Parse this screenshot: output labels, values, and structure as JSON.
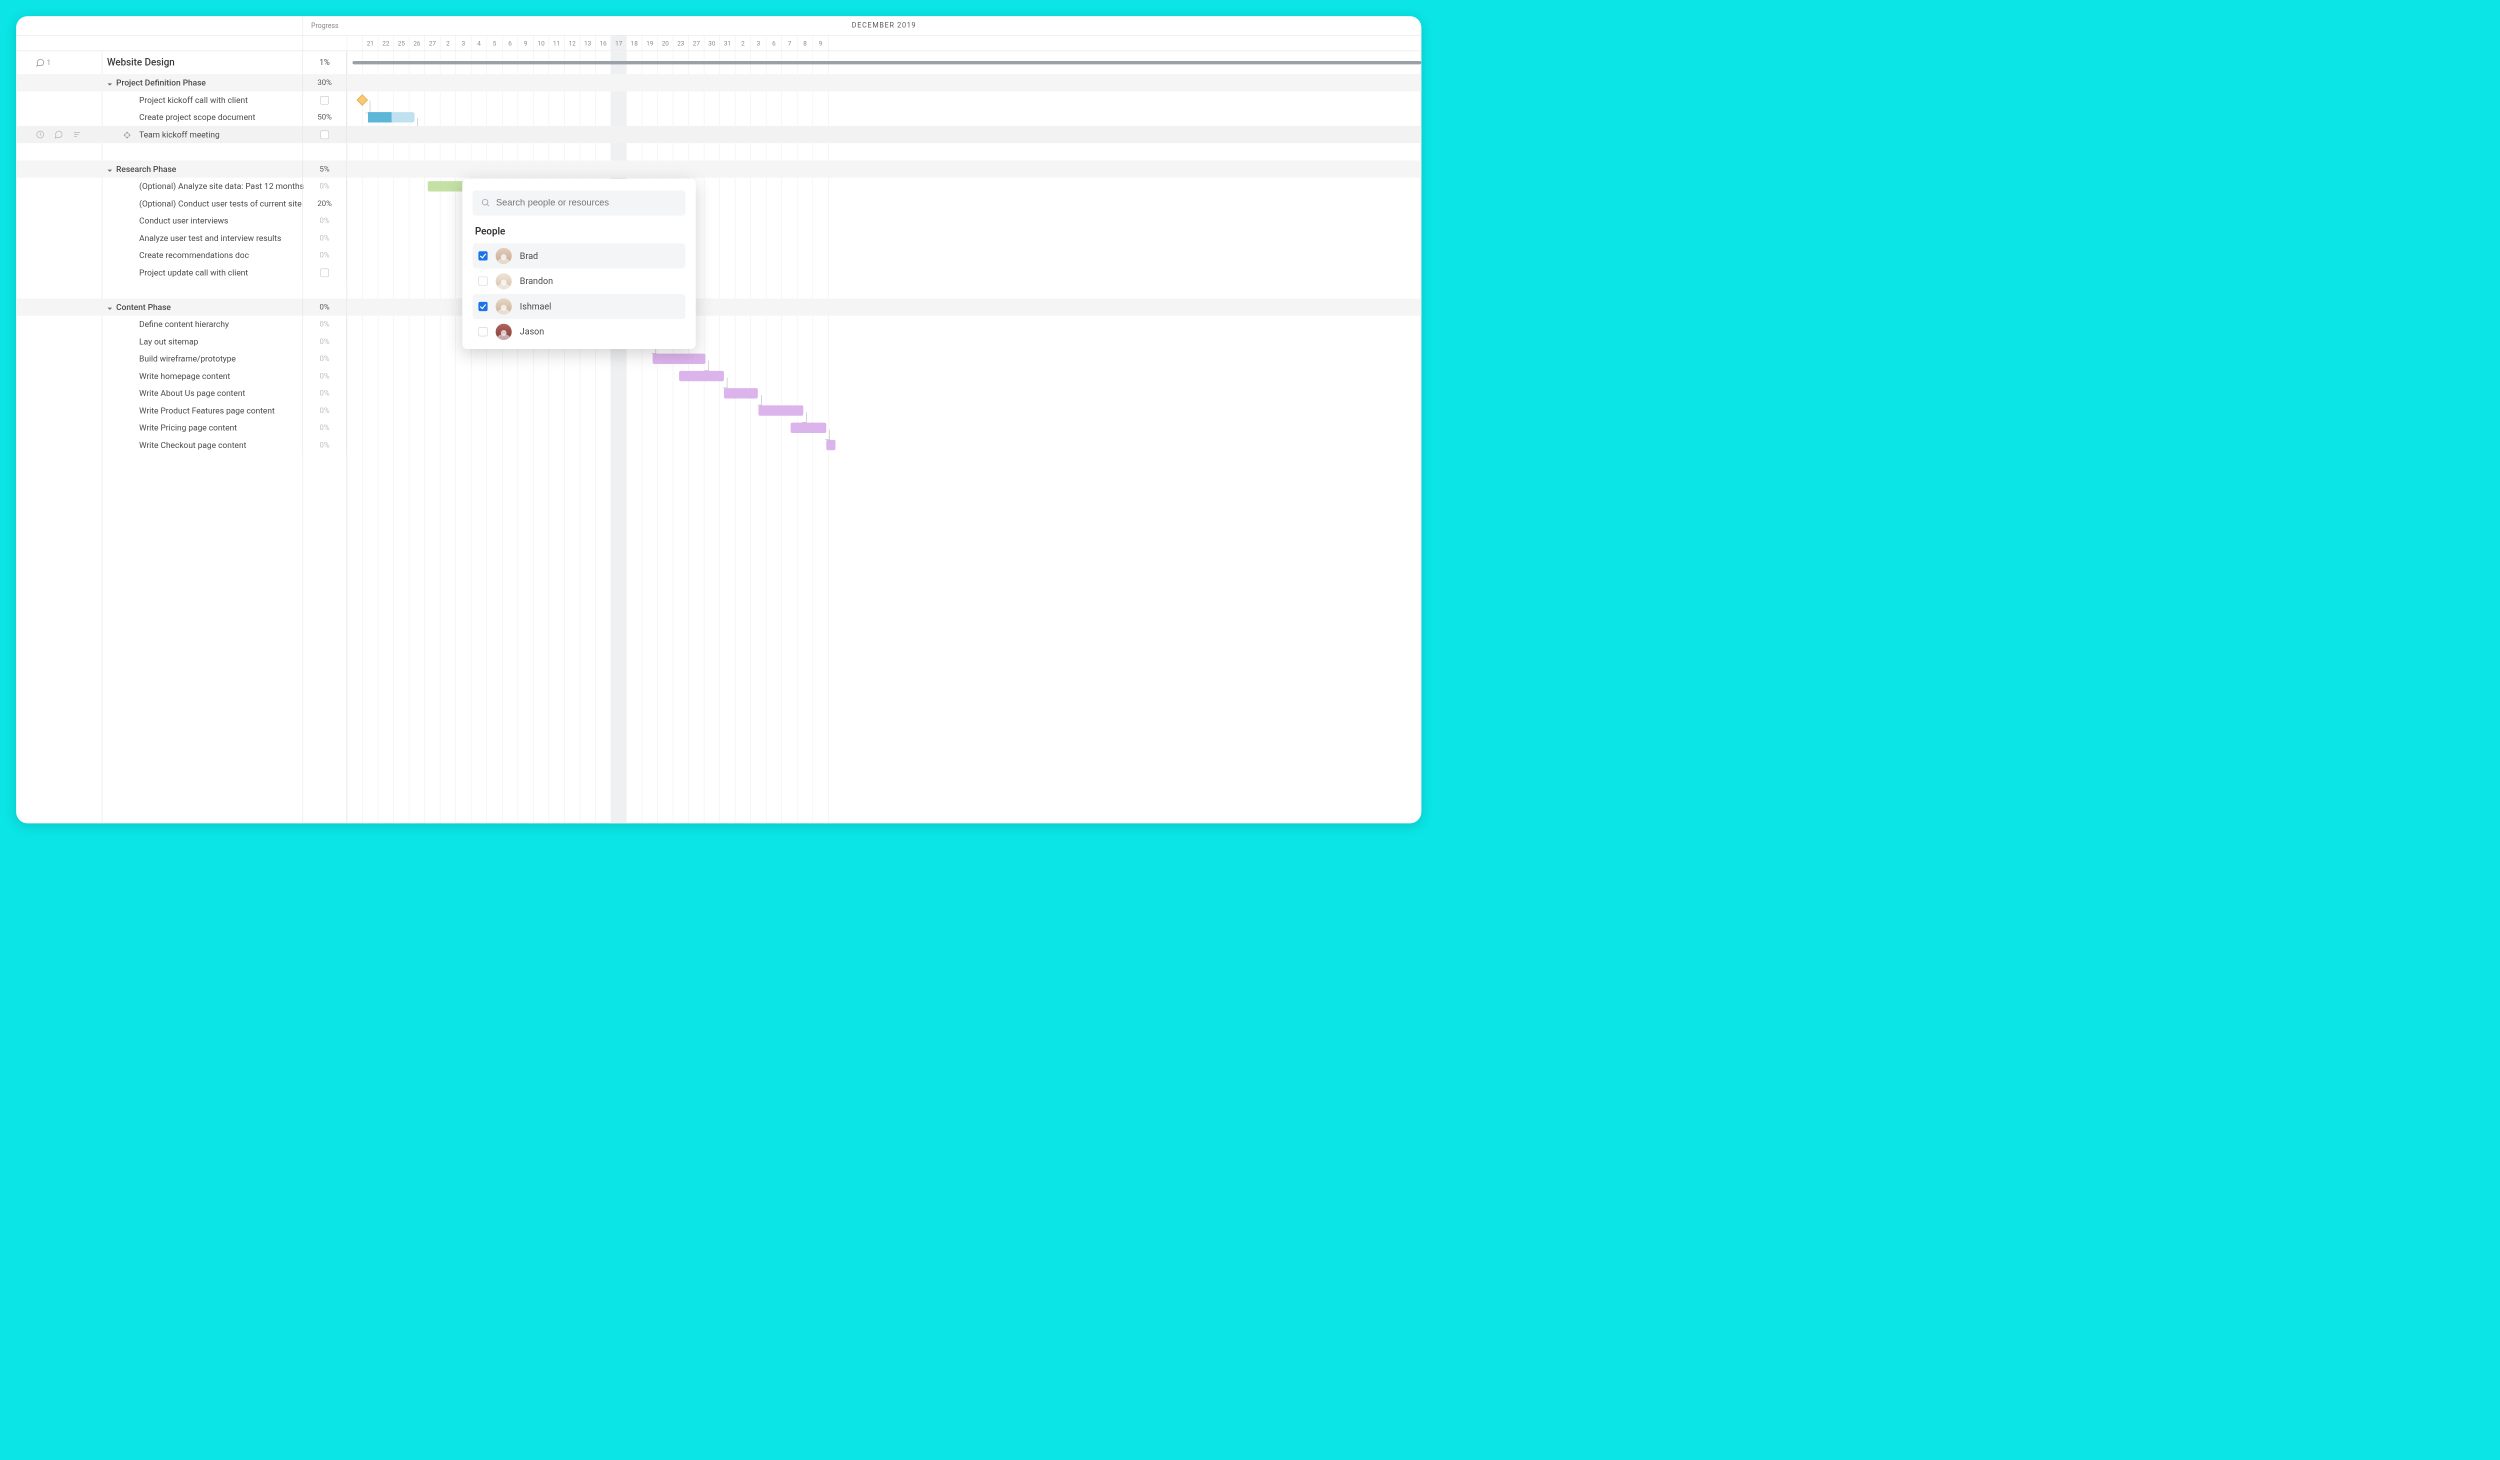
{
  "header": {
    "progress_label": "Progress",
    "month_label": "DECEMBER 2019",
    "dates": [
      {
        "d": ""
      },
      {
        "d": "21"
      },
      {
        "d": "22"
      },
      {
        "d": "25"
      },
      {
        "d": "26"
      },
      {
        "d": "27"
      },
      {
        "d": "2"
      },
      {
        "d": "3"
      },
      {
        "d": "4"
      },
      {
        "d": "5"
      },
      {
        "d": "6"
      },
      {
        "d": "9"
      },
      {
        "d": "10"
      },
      {
        "d": "11"
      },
      {
        "d": "12"
      },
      {
        "d": "13"
      },
      {
        "d": "16"
      },
      {
        "d": "17",
        "hl": true
      },
      {
        "d": "18"
      },
      {
        "d": "19"
      },
      {
        "d": "20"
      },
      {
        "d": "23"
      },
      {
        "d": "27"
      },
      {
        "d": "30"
      },
      {
        "d": "31"
      },
      {
        "d": "2"
      },
      {
        "d": "3"
      },
      {
        "d": "6"
      },
      {
        "d": "7"
      },
      {
        "d": "8"
      },
      {
        "d": "9"
      },
      {
        "d": ""
      }
    ]
  },
  "comment_badge": "1",
  "project": {
    "name": "Website Design",
    "progress": "1%"
  },
  "rows": [
    {
      "kind": "group",
      "indent": 1,
      "name": "Project Definition Phase",
      "progress": "30%",
      "shade": true
    },
    {
      "kind": "task",
      "indent": 2,
      "name": "Project kickoff call with client",
      "progress_box": true
    },
    {
      "kind": "task",
      "indent": 2,
      "name": "Create project scope document",
      "progress": "50%"
    },
    {
      "kind": "task",
      "indent": 2,
      "name": "Team kickoff meeting",
      "progress_box": true,
      "selected": true,
      "has_sel_icons": true
    },
    {
      "kind": "blank",
      "shade": false
    },
    {
      "kind": "group",
      "indent": 1,
      "name": "Research Phase",
      "progress": "5%",
      "shade": true
    },
    {
      "kind": "task",
      "indent": 2,
      "name": "(Optional) Analyze site data: Past 12 months",
      "progress": "0%",
      "dim": true
    },
    {
      "kind": "task",
      "indent": 2,
      "name": "(Optional) Conduct user tests of current site",
      "progress": "20%"
    },
    {
      "kind": "task",
      "indent": 2,
      "name": "Conduct user interviews",
      "progress": "0%",
      "dim": true
    },
    {
      "kind": "task",
      "indent": 2,
      "name": "Analyze user test and interview results",
      "progress": "0%",
      "dim": true
    },
    {
      "kind": "task",
      "indent": 2,
      "name": "Create recommendations doc",
      "progress": "0%",
      "dim": true
    },
    {
      "kind": "task",
      "indent": 2,
      "name": "Project update call with client",
      "progress_box": true
    },
    {
      "kind": "blank"
    },
    {
      "kind": "group",
      "indent": 1,
      "name": "Content Phase",
      "progress": "0%",
      "shade": true
    },
    {
      "kind": "task",
      "indent": 2,
      "name": "Define content hierarchy",
      "progress": "0%",
      "dim": true
    },
    {
      "kind": "task",
      "indent": 2,
      "name": "Lay out sitemap",
      "progress": "0%",
      "dim": true
    },
    {
      "kind": "task",
      "indent": 2,
      "name": "Build wireframe/prototype",
      "progress": "0%",
      "dim": true
    },
    {
      "kind": "task",
      "indent": 2,
      "name": "Write homepage content",
      "progress": "0%",
      "dim": true
    },
    {
      "kind": "task",
      "indent": 2,
      "name": "Write About Us page content",
      "progress": "0%",
      "dim": true
    },
    {
      "kind": "task",
      "indent": 2,
      "name": "Write Product Features page content",
      "progress": "0%",
      "dim": true
    },
    {
      "kind": "task",
      "indent": 2,
      "name": "Write Pricing page content",
      "progress": "0%",
      "dim": true
    },
    {
      "kind": "task",
      "indent": 2,
      "name": "Write Checkout page content",
      "progress": "0%",
      "dim": true
    }
  ],
  "popover": {
    "search_placeholder": "Search people or resources",
    "section_title": "People",
    "people": [
      {
        "name": "Brad",
        "checked": true,
        "avatar": "a1",
        "sel": true
      },
      {
        "name": "Brandon",
        "checked": false,
        "avatar": "a2"
      },
      {
        "name": "Ishmael",
        "checked": true,
        "avatar": "a3",
        "sel": true
      },
      {
        "name": "Jason",
        "checked": false,
        "avatar": "a4"
      }
    ]
  }
}
